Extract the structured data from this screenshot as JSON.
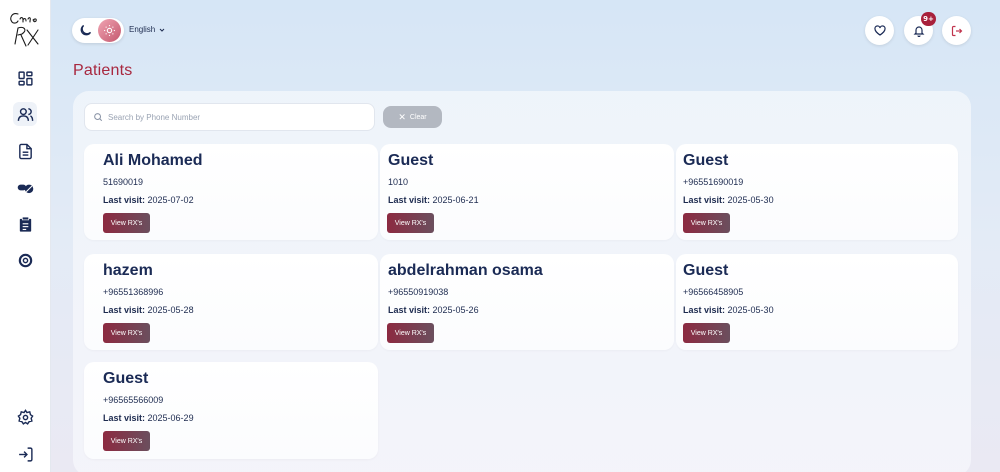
{
  "logo": {
    "text": "Care RX"
  },
  "sidebar": {
    "items": [
      {
        "icon": "dashboard-icon"
      },
      {
        "icon": "users-icon"
      },
      {
        "icon": "document-icon"
      },
      {
        "icon": "pills-icon"
      },
      {
        "icon": "clipboard-icon"
      },
      {
        "icon": "lifebuoy-icon"
      },
      {
        "icon": "gear-icon"
      },
      {
        "icon": "logout-icon"
      }
    ]
  },
  "topbar": {
    "language": "English",
    "notification_badge": "9+",
    "theme": "light"
  },
  "page": {
    "title": "Patients"
  },
  "search": {
    "placeholder": "Search by Phone Number",
    "value": "",
    "clear_label": "Clear"
  },
  "patients": [
    {
      "name": "Ali Mohamed",
      "phone": "51690019",
      "last_visit_label": "Last visit:",
      "last_visit": "2025-07-02",
      "button": "View RX's"
    },
    {
      "name": "Guest",
      "phone": "1010",
      "last_visit_label": "Last visit:",
      "last_visit": "2025-06-21",
      "button": "View RX's"
    },
    {
      "name": "Guest",
      "phone": "+96551690019",
      "last_visit_label": "Last visit:",
      "last_visit": "2025-05-30",
      "button": "View RX's"
    },
    {
      "name": "hazem",
      "phone": "+96551368996",
      "last_visit_label": "Last visit:",
      "last_visit": "2025-05-28",
      "button": "View RX's"
    },
    {
      "name": "abdelrahman osama",
      "phone": "+96550919038",
      "last_visit_label": "Last visit:",
      "last_visit": "2025-05-26",
      "button": "View RX's"
    },
    {
      "name": "Guest",
      "phone": "+96566458905",
      "last_visit_label": "Last visit:",
      "last_visit": "2025-05-30",
      "button": "View RX's"
    },
    {
      "name": "Guest",
      "phone": "+96565566009",
      "last_visit_label": "Last visit:",
      "last_visit": "2025-06-29",
      "button": "View RX's"
    }
  ],
  "colors": {
    "accent": "#a8283f",
    "navy": "#1a2a55",
    "button_start": "#8c2a41",
    "button_end": "#6b4f5e"
  }
}
